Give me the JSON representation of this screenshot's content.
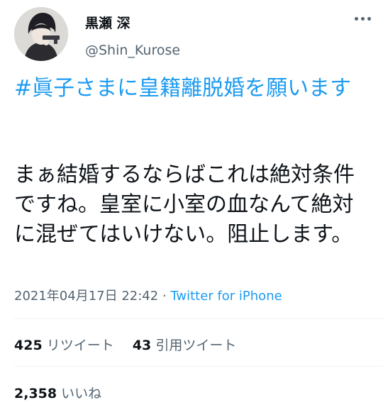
{
  "user": {
    "display_name": "黒瀬 深",
    "handle": "@Shin_Kurose"
  },
  "tweet": {
    "hashtag": "#眞子さまに皇籍離脱婚を願います",
    "body": "まぁ結婚するならばこれは絶対条件ですね。皇室に小室の血なんて絶対に混ぜてはいけない。阻止します。",
    "date": "2021年04月17日 22:42",
    "separator": " · ",
    "source": "Twitter for iPhone"
  },
  "stats": {
    "retweets": "425",
    "retweets_label": "リツイート",
    "quotes": "43",
    "quotes_label": "引用ツイート",
    "likes": "2,358",
    "likes_label": "いいね"
  },
  "icons": {
    "more": "more-dots-icon",
    "avatar": "avatar-illustration"
  },
  "colors": {
    "accent": "#1d9bf0",
    "text": "#0f1419",
    "muted": "#536471",
    "divider": "#eff3f4"
  }
}
